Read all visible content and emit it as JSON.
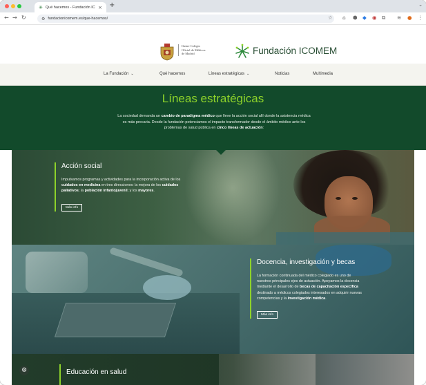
{
  "browser": {
    "tab_title": "Qué hacemos - Fundación ICOMEM",
    "tab_close": "×",
    "new_tab": "+",
    "url": "fundacionicomem.es/que-hacemos/"
  },
  "header": {
    "colegio_text": "Ilustre Colegio\nOficial de Médicos\nde Madrid",
    "brand": "Fundación ICOMEM"
  },
  "nav": {
    "items": [
      {
        "label": "La Fundación",
        "dropdown": true
      },
      {
        "label": "Qué hacemos",
        "dropdown": false
      },
      {
        "label": "Líneas estratégicas",
        "dropdown": true
      },
      {
        "label": "Noticias",
        "dropdown": false
      },
      {
        "label": "Multimedia",
        "dropdown": false
      }
    ]
  },
  "hero": {
    "title": "Líneas estratégicas",
    "intro": [
      {
        "t": "La sociedad demanda un ",
        "b": false
      },
      {
        "t": "cambio de paradigma médico",
        "b": true
      },
      {
        "t": " que lleve la acción social allí donde la asistencia médica es más precaria. Desde la fundación potenciamos el impacto transformador desde el ámbito médico ante los problemas de salud pública en ",
        "b": false
      },
      {
        "t": "cinco líneas de actuación",
        "b": true
      },
      {
        "t": ":",
        "b": false
      }
    ]
  },
  "sections": [
    {
      "title": "Acción social",
      "body": [
        {
          "t": "Impulsamos programas y actividades para la incorporación activa de los ",
          "b": false
        },
        {
          "t": "cuidados en medicina",
          "b": true
        },
        {
          "t": " en tres direcciones: la mejora de los ",
          "b": false
        },
        {
          "t": "cuidados paliativos",
          "b": true
        },
        {
          "t": "; la ",
          "b": false
        },
        {
          "t": "población infantojuvenil",
          "b": true
        },
        {
          "t": "; y los ",
          "b": false
        },
        {
          "t": "mayores",
          "b": true
        },
        {
          "t": ".",
          "b": false
        }
      ],
      "button": "Más info"
    },
    {
      "title": "Docencia, investigación y becas",
      "body": [
        {
          "t": "La formación continuada del médico colegiado es uno de nuestros principales ejes de actuación. Apoyamos la docencia mediante el desarrollo de ",
          "b": false
        },
        {
          "t": "becas de capacitación específica",
          "b": true
        },
        {
          "t": " destinado a médicos colegiados interesados en adquirir nuevas competencias y la ",
          "b": false
        },
        {
          "t": "investigación médica",
          "b": true
        },
        {
          "t": ".",
          "b": false
        }
      ],
      "button": "Más info"
    },
    {
      "title": "Educación en salud"
    }
  ],
  "colors": {
    "brand_green": "#124a2b",
    "accent_lime": "#8ed32a",
    "nav_bg": "#f4f4ef"
  },
  "icons": {
    "fab": "accessibility-icon"
  }
}
